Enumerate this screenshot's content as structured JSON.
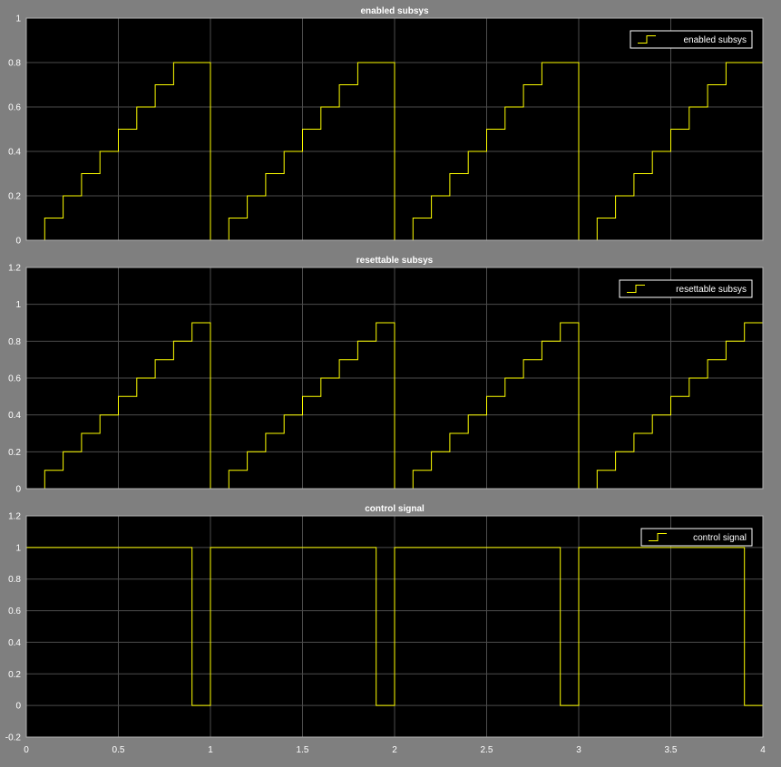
{
  "colors": {
    "figure_bg": "#7f7f7f",
    "axes_bg": "#000000",
    "grid": "#4d4d4d",
    "axis_line": "#b0b0b0",
    "tick_text": "#ffffff",
    "title_text": "#ffffff",
    "trace": "#ffff00",
    "legend_bg": "#000000",
    "legend_border": "#ffffff"
  },
  "chart_data": [
    {
      "type": "line",
      "step": true,
      "title": "enabled subsys",
      "xlabel": "",
      "ylabel": "",
      "xlim": [
        0,
        4
      ],
      "ylim": [
        0,
        1
      ],
      "xticks": [
        0,
        0.5,
        1,
        1.5,
        2,
        2.5,
        3,
        3.5,
        4
      ],
      "yticks": [
        0,
        0.2,
        0.4,
        0.6,
        0.8,
        1
      ],
      "grid": true,
      "legend": "top-right",
      "series": [
        {
          "name": "enabled subsys",
          "x": [
            0,
            0.1,
            0.2,
            0.3,
            0.4,
            0.5,
            0.6,
            0.7,
            0.8,
            1.0,
            1.1,
            1.2,
            1.3,
            1.4,
            1.5,
            1.6,
            1.7,
            1.8,
            2.0,
            2.1,
            2.2,
            2.3,
            2.4,
            2.5,
            2.6,
            2.7,
            2.8,
            3.0,
            3.1,
            3.2,
            3.3,
            3.4,
            3.5,
            3.6,
            3.7,
            3.8,
            4.0
          ],
          "y": [
            0,
            0.1,
            0.2,
            0.3,
            0.4,
            0.5,
            0.6,
            0.7,
            0.8,
            0,
            0.1,
            0.2,
            0.3,
            0.4,
            0.5,
            0.6,
            0.7,
            0.8,
            0,
            0.1,
            0.2,
            0.3,
            0.4,
            0.5,
            0.6,
            0.7,
            0.8,
            0,
            0.1,
            0.2,
            0.3,
            0.4,
            0.5,
            0.6,
            0.7,
            0.8,
            0.8
          ]
        }
      ]
    },
    {
      "type": "line",
      "step": true,
      "title": "resettable subsys",
      "xlabel": "",
      "ylabel": "",
      "xlim": [
        0,
        4
      ],
      "ylim": [
        0,
        1.2
      ],
      "xticks": [
        0,
        0.5,
        1,
        1.5,
        2,
        2.5,
        3,
        3.5,
        4
      ],
      "yticks": [
        0,
        0.2,
        0.4,
        0.6,
        0.8,
        1,
        1.2
      ],
      "grid": true,
      "legend": "top-right",
      "series": [
        {
          "name": "resettable subsys",
          "x": [
            0,
            0.1,
            0.2,
            0.3,
            0.4,
            0.5,
            0.6,
            0.7,
            0.8,
            0.9,
            1.0,
            1.1,
            1.2,
            1.3,
            1.4,
            1.5,
            1.6,
            1.7,
            1.8,
            1.9,
            2.0,
            2.1,
            2.2,
            2.3,
            2.4,
            2.5,
            2.6,
            2.7,
            2.8,
            2.9,
            3.0,
            3.1,
            3.2,
            3.3,
            3.4,
            3.5,
            3.6,
            3.7,
            3.8,
            3.9,
            4.0
          ],
          "y": [
            0,
            0.1,
            0.2,
            0.3,
            0.4,
            0.5,
            0.6,
            0.7,
            0.8,
            0.9,
            0,
            0.1,
            0.2,
            0.3,
            0.4,
            0.5,
            0.6,
            0.7,
            0.8,
            0.9,
            0,
            0.1,
            0.2,
            0.3,
            0.4,
            0.5,
            0.6,
            0.7,
            0.8,
            0.9,
            0,
            0.1,
            0.2,
            0.3,
            0.4,
            0.5,
            0.6,
            0.7,
            0.8,
            0.9,
            0.9
          ]
        }
      ]
    },
    {
      "type": "line",
      "step": true,
      "title": "control signal",
      "xlabel": "",
      "ylabel": "",
      "xlim": [
        0,
        4
      ],
      "ylim": [
        -0.2,
        1.2
      ],
      "xticks": [
        0,
        0.5,
        1,
        1.5,
        2,
        2.5,
        3,
        3.5,
        4
      ],
      "yticks": [
        -0.2,
        0,
        0.2,
        0.4,
        0.6,
        0.8,
        1,
        1.2
      ],
      "grid": true,
      "legend": "top-right",
      "show_xtick_labels": true,
      "series": [
        {
          "name": "control signal",
          "x": [
            0,
            0.9,
            1.0,
            1.9,
            2.0,
            2.9,
            3.0,
            3.9,
            4.0
          ],
          "y": [
            1,
            0,
            1,
            0,
            1,
            0,
            1,
            0,
            0
          ]
        }
      ]
    }
  ]
}
